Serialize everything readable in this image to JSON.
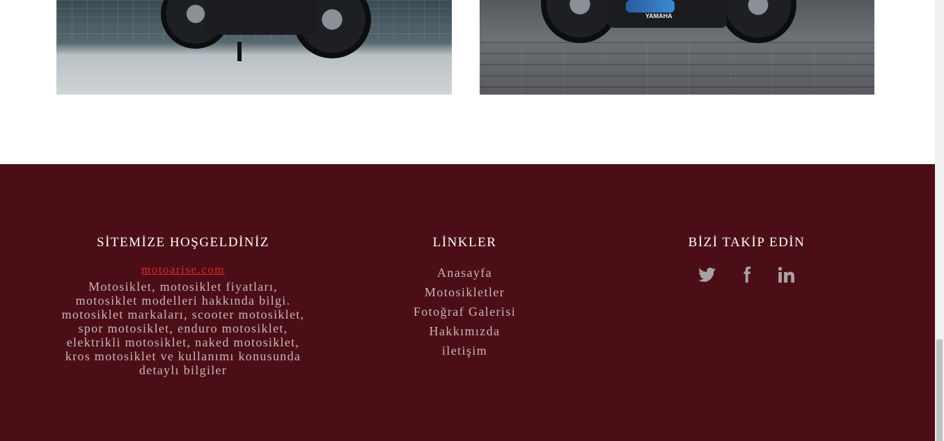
{
  "gallery": {
    "left_photo": {
      "icon": "motorcycle-photo"
    },
    "right_photo": {
      "icon": "motorcycle-photo",
      "brand_text": "YAMAHA"
    }
  },
  "footer": {
    "welcome": {
      "title": "SİTEMİZE HOŞGELDİNİZ",
      "site_link": "motoarise.com",
      "description": "Motosiklet, motosiklet fiyatları, motosiklet modelleri hakkında bilgi. motosiklet markaları, scooter motosiklet, spor motosiklet, enduro motosiklet, elektrikli motosiklet, naked motosiklet, kros motosiklet ve kullanımı konusunda detaylı bilgiler"
    },
    "links": {
      "title": "LİNKLER",
      "items": [
        "Anasayfa",
        "Motosikletler",
        "Fotoğraf Galerisi",
        "Hakkımızda",
        "iletişim"
      ]
    },
    "follow": {
      "title": "BİZİ TAKİP EDİN",
      "icons": [
        "twitter-icon",
        "facebook-icon",
        "linkedin-icon"
      ]
    }
  },
  "colors": {
    "footer_bg": "#4c0e16",
    "link_red": "#e0272b",
    "muted_text": "#c9b7ba",
    "icon_gray": "#a7a3a4"
  }
}
